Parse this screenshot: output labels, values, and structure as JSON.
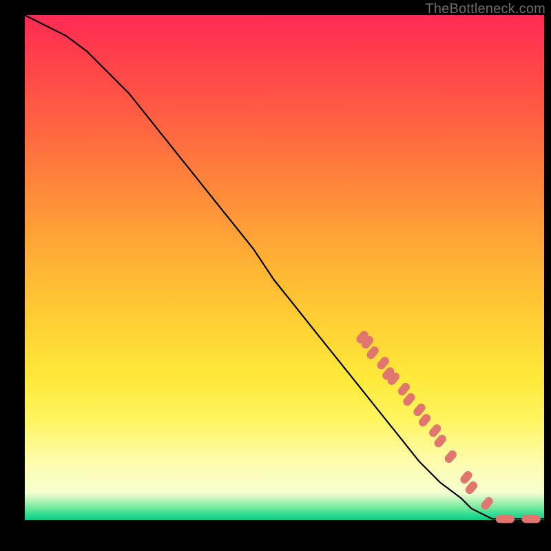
{
  "watermark": "TheBottleneck.com",
  "colors": {
    "line": "#000000",
    "marker_fill": "#e0766e",
    "marker_stroke": "#cf6a63"
  },
  "chart_data": {
    "type": "line",
    "title": "",
    "xlabel": "",
    "ylabel": "",
    "xlim": [
      0,
      100
    ],
    "ylim": [
      0,
      100
    ],
    "grid": false,
    "legend": false,
    "note": "Axes are unlabeled; values are normalized 0–100 estimated from pixel positions.",
    "series": [
      {
        "name": "curve",
        "kind": "line",
        "x": [
          0,
          4,
          8,
          12,
          16,
          20,
          24,
          28,
          32,
          36,
          40,
          44,
          48,
          52,
          56,
          60,
          64,
          68,
          72,
          76,
          80,
          84,
          86,
          88,
          90,
          92,
          94,
          96,
          98,
          100
        ],
        "y": [
          100,
          98,
          96,
          93,
          89,
          85,
          80,
          75,
          70,
          65,
          60,
          55,
          49,
          44,
          39,
          34,
          29,
          24,
          19,
          14,
          10,
          7,
          5,
          4,
          3,
          3,
          3,
          3,
          3,
          3
        ]
      },
      {
        "name": "markers",
        "kind": "scatter",
        "x": [
          65,
          66,
          67,
          69,
          70,
          71,
          73,
          74,
          76,
          77,
          79,
          80,
          82,
          85,
          86,
          89,
          92,
          93,
          97,
          98
        ],
        "y": [
          38,
          37,
          35,
          33,
          31,
          30,
          28,
          26,
          24,
          22,
          20,
          18,
          15,
          11,
          9,
          6,
          3,
          3,
          3,
          3
        ]
      }
    ]
  }
}
